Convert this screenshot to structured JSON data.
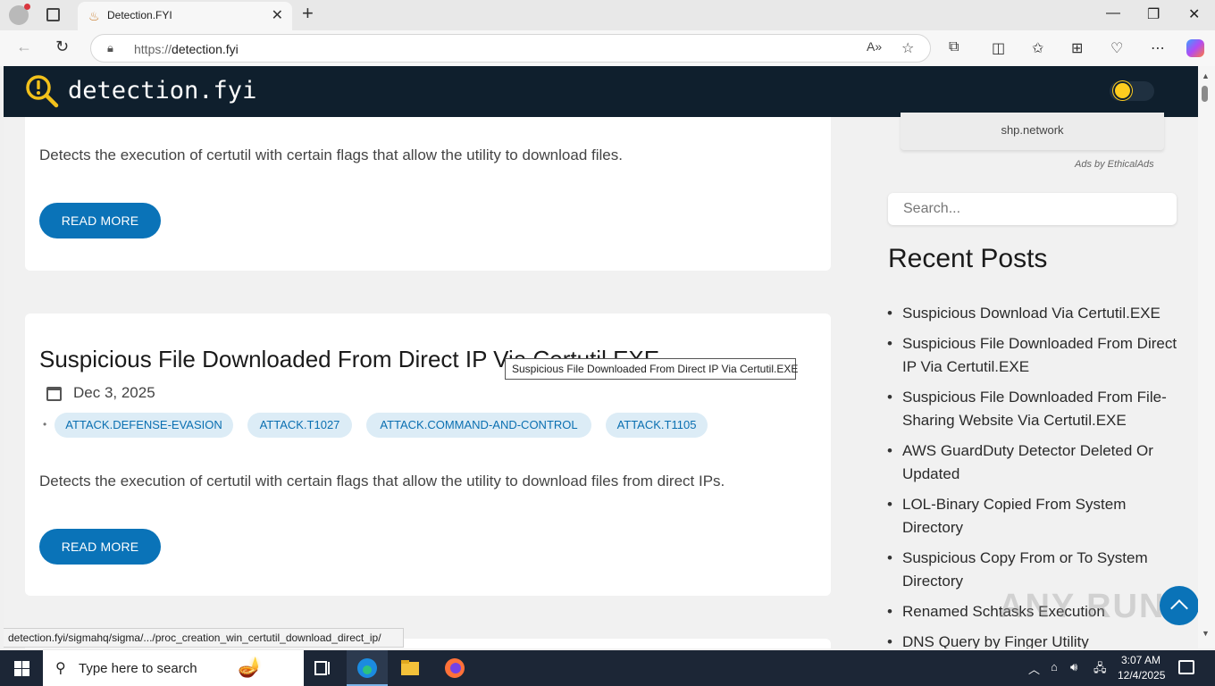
{
  "browser": {
    "tab_title": "Detection.FYI",
    "url_proto": "https://",
    "url_host": "detection.fyi",
    "status_url": "detection.fyi/sigmahq/sigma/.../proc_creation_win_certutil_download_direct_ip/"
  },
  "site": {
    "logo_text": "detection.fyi"
  },
  "post_prev": {
    "description": "Detects the execution of certutil with certain flags that allow the utility to download files.",
    "read_more": "READ MORE"
  },
  "post": {
    "title": "Suspicious File Downloaded From Direct IP Via Certutil.EXE",
    "date": "Dec 3, 2025",
    "tags": [
      "ATTACK.DEFENSE-EVASION",
      "ATTACK.T1027",
      "ATTACK.COMMAND-AND-CONTROL",
      "ATTACK.T1105"
    ],
    "description": "Detects the execution of certutil with certain flags that allow the utility to download files from direct IPs.",
    "read_more": "READ MORE",
    "tooltip": "Suspicious File Downloaded From Direct IP Via Certutil.EXE"
  },
  "sidebar": {
    "ad_site": "shp.network",
    "ads_by": "Ads by EthicalAds",
    "search_placeholder": "Search...",
    "recent_heading": "Recent Posts",
    "recent": [
      "Suspicious Download Via Certutil.EXE",
      "Suspicious File Downloaded From Direct IP Via Certutil.EXE",
      "Suspicious File Downloaded From File-Sharing Website Via Certutil.EXE",
      "AWS GuardDuty Detector Deleted Or Updated",
      "LOL-Binary Copied From System Directory",
      "Suspicious Copy From or To System Directory",
      "Renamed Schtasks Execution",
      "DNS Query by Finger Utility"
    ]
  },
  "taskbar": {
    "search_placeholder": "Type here to search",
    "time": "3:07 AM",
    "date": "12/4/2025"
  },
  "watermark": "ANY RUN",
  "colors": {
    "header_bg": "#0f1f2d",
    "accent": "#0a73b8",
    "tag_bg": "#dcecf6"
  }
}
